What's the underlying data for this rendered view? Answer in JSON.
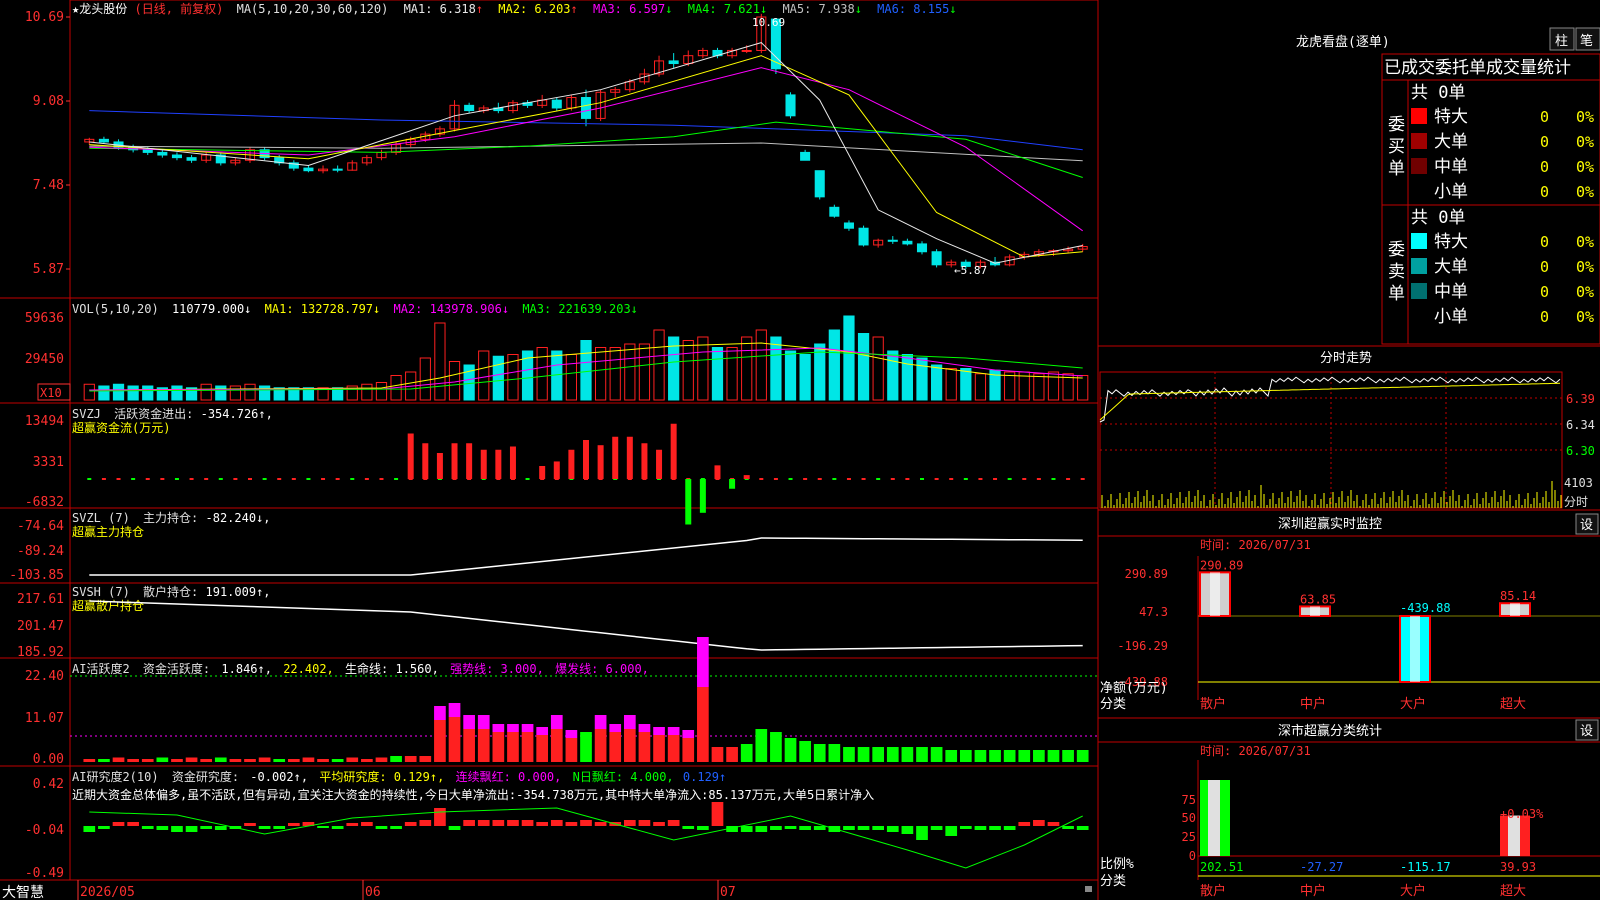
{
  "colors": {
    "up": "#ff2020",
    "down": "#00e6e6",
    "ma1": "#e8e8e8",
    "ma2": "#ffff00",
    "ma3": "#ff00ff",
    "ma4": "#00ff00",
    "ma5": "#c0c0c0",
    "ma6": "#2040ff",
    "grid": "#c00000",
    "axis": "#ff3030",
    "panel_title": "#e0e0e0",
    "yellow": "#ffff00",
    "magenta": "#ff00ff",
    "green": "#00ff00",
    "cyan": "#00ffff"
  },
  "main": {
    "stock_name": "★龙头股份",
    "period": "(日线, 前复权)",
    "ma_params": "MA(5,10,20,30,60,120)",
    "ma_values": [
      {
        "label": "MA1: 6.318",
        "arrow": "↑"
      },
      {
        "label": "MA2: 6.203",
        "arrow": "↑"
      },
      {
        "label": "MA3: 6.597",
        "arrow": "↓"
      },
      {
        "label": "MA4: 7.621",
        "arrow": "↓"
      },
      {
        "label": "MA5: 7.938",
        "arrow": "↓"
      },
      {
        "label": "MA6: 8.155",
        "arrow": "↓"
      }
    ],
    "y_ticks": [
      "10.69",
      "9.08",
      "7.48",
      "5.87"
    ],
    "high_label": "10.69",
    "low_label": "←5.87",
    "candles": [
      [
        8.3,
        8.38,
        8.25,
        8.35
      ],
      [
        8.35,
        8.4,
        8.28,
        8.3
      ],
      [
        8.3,
        8.35,
        8.15,
        8.2
      ],
      [
        8.2,
        8.25,
        8.1,
        8.15
      ],
      [
        8.15,
        8.2,
        8.05,
        8.1
      ],
      [
        8.1,
        8.15,
        8.0,
        8.05
      ],
      [
        8.05,
        8.1,
        7.95,
        8.0
      ],
      [
        8.0,
        8.05,
        7.9,
        7.95
      ],
      [
        7.95,
        8.1,
        7.9,
        8.05
      ],
      [
        8.05,
        8.1,
        7.85,
        7.9
      ],
      [
        7.9,
        8.0,
        7.85,
        7.95
      ],
      [
        7.95,
        8.2,
        7.9,
        8.15
      ],
      [
        8.15,
        8.2,
        7.95,
        8.0
      ],
      [
        8.0,
        8.05,
        7.85,
        7.9
      ],
      [
        7.9,
        7.95,
        7.75,
        7.8
      ],
      [
        7.8,
        7.85,
        7.72,
        7.75
      ],
      [
        7.75,
        7.85,
        7.7,
        7.78
      ],
      [
        7.78,
        7.85,
        7.72,
        7.76
      ],
      [
        7.76,
        7.95,
        7.75,
        7.9
      ],
      [
        7.9,
        8.05,
        7.85,
        8.0
      ],
      [
        8.0,
        8.15,
        7.95,
        8.1
      ],
      [
        8.1,
        8.3,
        8.05,
        8.25
      ],
      [
        8.25,
        8.4,
        8.2,
        8.35
      ],
      [
        8.35,
        8.5,
        8.3,
        8.45
      ],
      [
        8.45,
        8.6,
        8.4,
        8.55
      ],
      [
        8.55,
        9.1,
        8.5,
        9.0
      ],
      [
        9.0,
        9.05,
        8.85,
        8.9
      ],
      [
        8.9,
        9.0,
        8.85,
        8.95
      ],
      [
        8.95,
        9.05,
        8.85,
        8.9
      ],
      [
        8.9,
        9.1,
        8.85,
        9.05
      ],
      [
        9.05,
        9.1,
        8.95,
        9.0
      ],
      [
        9.0,
        9.2,
        8.95,
        9.1
      ],
      [
        9.1,
        9.15,
        8.9,
        8.95
      ],
      [
        8.95,
        9.2,
        8.9,
        9.15
      ],
      [
        9.15,
        9.3,
        8.6,
        8.75
      ],
      [
        8.75,
        9.3,
        8.7,
        9.25
      ],
      [
        9.25,
        9.35,
        9.15,
        9.3
      ],
      [
        9.3,
        9.5,
        9.25,
        9.45
      ],
      [
        9.45,
        9.7,
        9.4,
        9.6
      ],
      [
        9.6,
        9.95,
        9.55,
        9.85
      ],
      [
        9.85,
        10.0,
        9.7,
        9.8
      ],
      [
        9.8,
        10.05,
        9.75,
        9.95
      ],
      [
        9.95,
        10.1,
        9.9,
        10.05
      ],
      [
        10.05,
        10.1,
        9.9,
        9.95
      ],
      [
        9.95,
        10.1,
        9.9,
        10.05
      ],
      [
        10.05,
        10.15,
        10.0,
        10.05
      ],
      [
        10.05,
        10.75,
        10.0,
        10.69
      ],
      [
        10.65,
        10.65,
        9.6,
        9.7
      ],
      [
        9.2,
        9.25,
        8.75,
        8.8
      ],
      [
        8.1,
        8.15,
        7.95,
        7.95
      ],
      [
        7.75,
        7.75,
        7.2,
        7.25
      ],
      [
        7.05,
        7.1,
        6.85,
        6.88
      ],
      [
        6.75,
        6.8,
        6.6,
        6.65
      ],
      [
        6.65,
        6.7,
        6.3,
        6.33
      ],
      [
        6.33,
        6.45,
        6.28,
        6.42
      ],
      [
        6.42,
        6.5,
        6.35,
        6.4
      ],
      [
        6.4,
        6.45,
        6.32,
        6.35
      ],
      [
        6.35,
        6.4,
        6.15,
        6.2
      ],
      [
        6.2,
        6.25,
        5.9,
        5.95
      ],
      [
        5.95,
        6.05,
        5.9,
        6.0
      ],
      [
        6.0,
        6.05,
        5.87,
        5.92
      ],
      [
        5.92,
        6.05,
        5.88,
        6.0
      ],
      [
        6.0,
        6.1,
        5.92,
        5.95
      ],
      [
        5.95,
        6.15,
        5.92,
        6.1
      ],
      [
        6.1,
        6.2,
        6.05,
        6.15
      ],
      [
        6.15,
        6.25,
        6.1,
        6.2
      ],
      [
        6.2,
        6.25,
        6.12,
        6.22
      ],
      [
        6.22,
        6.3,
        6.18,
        6.25
      ],
      [
        6.25,
        6.35,
        6.2,
        6.3
      ]
    ],
    "ma6_line": [
      [
        0,
        8.9
      ],
      [
        20,
        8.72
      ],
      [
        40,
        8.62
      ],
      [
        60,
        8.42
      ],
      [
        68,
        8.15
      ]
    ],
    "ma5_line": [
      [
        0,
        8.22
      ],
      [
        20,
        8.18
      ],
      [
        46,
        8.28
      ],
      [
        68,
        7.94
      ]
    ],
    "ma4_line": [
      [
        0,
        8.18
      ],
      [
        20,
        8.1
      ],
      [
        30,
        8.22
      ],
      [
        40,
        8.4
      ],
      [
        47,
        8.68
      ],
      [
        60,
        8.35
      ],
      [
        68,
        7.62
      ]
    ],
    "ma3_line": [
      [
        0,
        8.2
      ],
      [
        15,
        8.05
      ],
      [
        25,
        8.4
      ],
      [
        35,
        8.95
      ],
      [
        46,
        9.72
      ],
      [
        52,
        9.3
      ],
      [
        60,
        8.2
      ],
      [
        68,
        6.6
      ]
    ],
    "ma2_line": [
      [
        0,
        8.25
      ],
      [
        15,
        7.98
      ],
      [
        25,
        8.52
      ],
      [
        35,
        9.05
      ],
      [
        46,
        9.95
      ],
      [
        52,
        9.2
      ],
      [
        58,
        6.95
      ],
      [
        64,
        6.1
      ],
      [
        68,
        6.2
      ]
    ],
    "ma1_line": [
      [
        0,
        8.3
      ],
      [
        15,
        7.85
      ],
      [
        25,
        8.8
      ],
      [
        35,
        9.3
      ],
      [
        46,
        10.2
      ],
      [
        50,
        9.1
      ],
      [
        54,
        7.0
      ],
      [
        58,
        6.45
      ],
      [
        62,
        5.98
      ],
      [
        68,
        6.32
      ]
    ]
  },
  "vol": {
    "title": "VOL(5,10,20)",
    "value": "110779.000↓",
    "ma1": "MA1: 132728.797↓",
    "ma2": "MA2: 143978.906↓",
    "ma3": "MA3: 221639.203↓",
    "y_ticks": [
      "59636",
      "29450"
    ],
    "x10": "X10",
    "values": [
      9,
      8,
      9,
      8,
      8,
      7,
      8,
      7,
      9,
      8,
      8,
      9,
      8,
      7,
      7,
      7,
      7,
      7,
      8,
      9,
      10,
      14,
      16,
      24,
      44,
      22,
      20,
      28,
      25,
      26,
      28,
      30,
      28,
      26,
      34,
      30,
      30,
      32,
      32,
      40,
      36,
      34,
      36,
      30,
      30,
      36,
      40,
      36,
      28,
      26,
      32,
      40,
      48,
      38,
      36,
      28,
      26,
      24,
      20,
      18,
      18,
      15,
      17,
      16,
      16,
      15,
      16,
      15,
      14
    ]
  },
  "svzj": {
    "title": "SVZJ",
    "label": "活跃资金进出:",
    "value": "-354.726↑,",
    "subtitle": "超赢资金流(万元)",
    "y_ticks": [
      "13494",
      "3331",
      "-6832"
    ],
    "values": [
      0,
      0,
      0,
      0,
      0,
      0,
      0,
      0,
      0,
      0,
      0,
      0,
      0,
      0,
      0,
      0,
      0,
      0,
      0,
      0,
      0,
      0,
      0,
      0,
      0,
      0,
      0,
      0,
      0,
      0,
      0,
      0,
      0,
      0,
      0,
      0,
      0,
      0,
      0,
      0,
      0,
      0,
      0,
      0,
      0,
      0,
      0,
      0,
      0,
      0,
      0,
      0,
      0,
      0,
      0,
      0,
      0,
      0,
      0,
      0,
      0,
      0,
      0,
      0,
      0,
      0,
      0,
      0,
      0
    ],
    "bars": [
      [
        22,
        7000
      ],
      [
        23,
        5500
      ],
      [
        24,
        4000
      ],
      [
        25,
        5500
      ],
      [
        26,
        5500
      ],
      [
        27,
        4500
      ],
      [
        28,
        4500
      ],
      [
        29,
        5000
      ],
      [
        31,
        2000
      ],
      [
        32,
        2700
      ],
      [
        33,
        4500
      ],
      [
        34,
        6000
      ],
      [
        35,
        5200
      ],
      [
        36,
        6500
      ],
      [
        37,
        6500
      ],
      [
        38,
        5500
      ],
      [
        39,
        4500
      ],
      [
        40,
        8500
      ],
      [
        41,
        -7000
      ],
      [
        42,
        -5200
      ],
      [
        43,
        2100
      ],
      [
        44,
        -1500
      ],
      [
        45,
        600
      ]
    ]
  },
  "svzl": {
    "title": "SVZL (7)",
    "label": "主力持仓:",
    "value": "-82.240↓,",
    "subtitle": "超赢主力持仓",
    "y_ticks": [
      "-74.64",
      "-89.24",
      "-103.85"
    ]
  },
  "svsh": {
    "title": "SVSH (7)",
    "label": "散户持仓:",
    "value": "191.009↑,",
    "subtitle": "超赢散户持仓",
    "y_ticks": [
      "217.61",
      "201.47",
      "185.92"
    ]
  },
  "ai_act": {
    "title": "AI活跃度2",
    "label": "资金活跃度:",
    "value": "1.846↑,",
    "v2": "22.402,",
    "life": "生命线: 1.560,",
    "strong": "强势线: 3.000,",
    "burst": "爆发线: 6.000,",
    "y_ticks": [
      "22.40",
      "11.07",
      "0.00"
    ]
  },
  "ai_res": {
    "title": "AI研究度2(10)",
    "label": "资金研究度:",
    "value": "-0.002↑,",
    "avg": "平均研究度: 0.129↑,",
    "red": "连续飘红: 0.000,",
    "nred": "N日飘红: 4.000,",
    "extra": "0.129↑",
    "note": "近期大资金总体偏多,虽不活跃,但有异动,宜关注大资金的持续性,今日大单净流出:-354.738万元,其中特大单净流入:85.137万元,大单5日累计净入",
    "y_ticks": [
      "0.42",
      "-0.04",
      "-0.49"
    ]
  },
  "xaxis": {
    "brand": "大智慧",
    "labels": [
      "2026/05",
      "06",
      "07"
    ]
  },
  "dragon": {
    "title": "龙虎看盘(逐单)",
    "btn1": "柱",
    "btn2": "笔",
    "header": "已成交委托单成交量统计",
    "buy": {
      "side": "委买单",
      "total": "共 0单",
      "rows": [
        {
          "name": "特大",
          "count": "0",
          "pct": "0%",
          "color": "#ff0000"
        },
        {
          "name": "大单",
          "count": "0",
          "pct": "0%",
          "color": "#a00000"
        },
        {
          "name": "中单",
          "count": "0",
          "pct": "0%",
          "color": "#700000"
        },
        {
          "name": "小单",
          "count": "0",
          "pct": "0%",
          "color": ""
        }
      ]
    },
    "sell": {
      "side": "委卖单",
      "total": "共 0单",
      "rows": [
        {
          "name": "特大",
          "count": "0",
          "pct": "0%",
          "color": "#00ffff"
        },
        {
          "name": "大单",
          "count": "0",
          "pct": "0%",
          "color": "#00a0a0"
        },
        {
          "name": "中单",
          "count": "0",
          "pct": "0%",
          "color": "#007070"
        },
        {
          "name": "小单",
          "count": "0",
          "pct": "0%",
          "color": ""
        }
      ]
    }
  },
  "intraday": {
    "title": "分时走势",
    "ticks": [
      "6.39",
      "6.34",
      "6.30"
    ],
    "vol_tick": "4103",
    "vol_label": "分时"
  },
  "sz_monitor": {
    "title": "深圳超赢实时监控",
    "settings": "设",
    "time": "时间: 2026/07/31",
    "y_ticks": [
      "290.89",
      "47.3",
      "-196.29",
      "-439.88"
    ],
    "y_label": "净额(万元)",
    "x_label": "分类",
    "categories": [
      "散户",
      "中户",
      "大户",
      "超大"
    ],
    "values": [
      290.89,
      63.85,
      -439.88,
      85.14
    ],
    "value_labels": [
      "290.89",
      "63.85",
      "-439.88",
      "85.14"
    ]
  },
  "sz_stats": {
    "title": "深市超赢分类统计",
    "settings": "设",
    "time": "时间: 2026/07/31",
    "y_ticks": [
      "75",
      "50",
      "25",
      "0"
    ],
    "y_label": "比例%",
    "x_label": "分类",
    "categories": [
      "散户",
      "中户",
      "大户",
      "超大"
    ],
    "values": [
      202.51,
      -27.27,
      -115.17,
      39.93
    ],
    "value_labels": [
      "202.51",
      "-27.27",
      "-115.17",
      "39.93"
    ],
    "annot": "+0.03%"
  }
}
